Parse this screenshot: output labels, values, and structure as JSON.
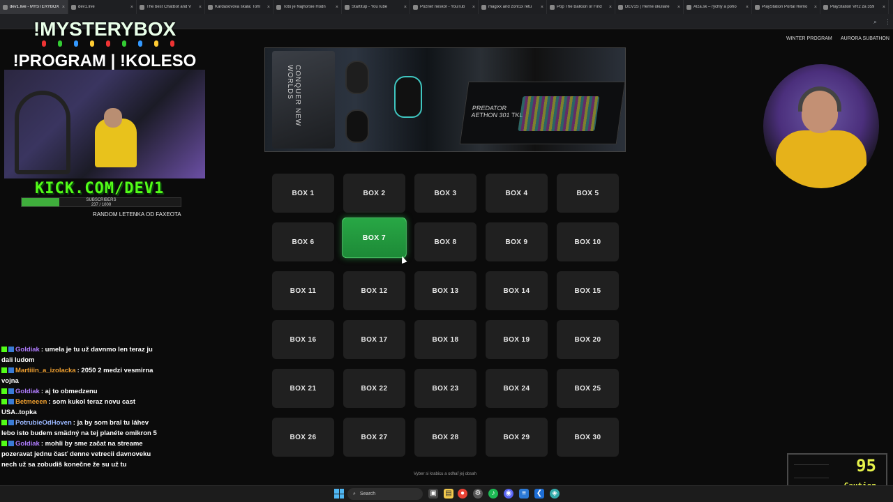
{
  "browser": {
    "tabs": [
      {
        "label": "dev1.live - MYSTERYBOX",
        "active": true
      },
      {
        "label": "dev1.live",
        "active": false
      },
      {
        "label": "The best ChatBot and V",
        "active": false
      },
      {
        "label": "Kardašovova škála: Tohl",
        "active": false
      },
      {
        "label": "Toto je Najhoršie Hodn",
        "active": false
      },
      {
        "label": "Startitup - YouTube",
        "active": false
      },
      {
        "label": "Pozrieť neskôr - YouTub",
        "active": false
      },
      {
        "label": "magixx and zont1x retu",
        "active": false
      },
      {
        "label": "Pop The Balloon or Find",
        "active": false
      },
      {
        "label": "DEV1S | Herné okuliare",
        "active": false
      },
      {
        "label": "Alza.sk – rýchly a poho",
        "active": false
      },
      {
        "label": "PlayStation Portal Remo",
        "active": false
      },
      {
        "label": "PlayStation VR2 za 359",
        "active": false
      }
    ],
    "close_glyph": "×"
  },
  "overlay": {
    "title_line1": "!MYSTERYBOX",
    "title_line2": "!PROGRAM | !KOLESO",
    "kick_url": "KICK.COM/DEV1",
    "subs_label": "SUBSCRIBERS",
    "subs_count": "237 / 1000",
    "subs_fraction": 0.237,
    "random_text": "RANDOM LETENKA OD FAXEOTA"
  },
  "nav_links": {
    "winter": "WINTER PROGRAM",
    "aurora": "AURORA SUBATHON"
  },
  "product": {
    "brand_line1": "PREDATOR",
    "brand_line2": "AETHON 301 TKL",
    "pad_text": "CONQUER NEW WORLDS"
  },
  "boxes": [
    "BOX 1",
    "BOX 2",
    "BOX 3",
    "BOX 4",
    "BOX 5",
    "BOX 6",
    "BOX 7",
    "BOX 8",
    "BOX 9",
    "BOX 10",
    "BOX 11",
    "BOX 12",
    "BOX 13",
    "BOX 14",
    "BOX 15",
    "BOX 16",
    "BOX 17",
    "BOX 18",
    "BOX 19",
    "BOX 20",
    "BOX 21",
    "BOX 22",
    "BOX 23",
    "BOX 24",
    "BOX 25",
    "BOX 26",
    "BOX 27",
    "BOX 28",
    "BOX 29",
    "BOX 30"
  ],
  "selected_box": "BOX 7",
  "hint": "Vyber si krabicu a odhaľ jej obsah",
  "chat": [
    {
      "user": "Goldiak",
      "color": "#b07cff",
      "text": "umela je tu už davnmo len teraz ju dali ludom"
    },
    {
      "user": "Martiiin_a_izolacka",
      "color": "#f0a030",
      "text": "2050 2 medzi vesmirna vojna"
    },
    {
      "user": "Goldiak",
      "color": "#b07cff",
      "text": "aj to obmedzenu"
    },
    {
      "user": "Betmeeen",
      "color": "#f0a030",
      "text": "som kukol teraz novu cast USA..topka"
    },
    {
      "user": "PotrubieOdHoven",
      "color": "#9bb8ff",
      "text": "ja by som bral tu láhev lebo isto budem smädný na tej planéte omikron 5"
    },
    {
      "user": "Goldiak",
      "color": "#b07cff",
      "text": "mohli by sme začat na streame pozeravat jednu časť denne vetrecii davnoveku nech už sa zobudiš konečne že su už tu"
    }
  ],
  "caution_widget": {
    "value": "95",
    "label": "Caution"
  },
  "taskbar": {
    "search_label": "Search"
  }
}
